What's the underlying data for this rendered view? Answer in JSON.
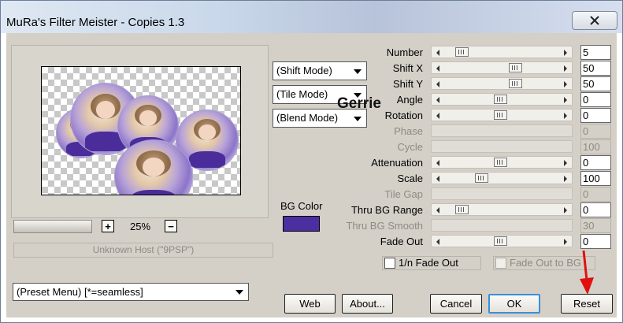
{
  "window": {
    "title": "MuRa's Filter Meister - Copies 1.3"
  },
  "preview": {
    "zoom": "25%",
    "host": "Unknown Host (\"9PSP\")"
  },
  "modes": {
    "shift": "(Shift Mode)",
    "tile": "(Tile Mode)",
    "blend": "(Blend Mode)"
  },
  "overlay_name": "Gerrie",
  "bg_color": {
    "label": "BG Color",
    "value": "#4b2fa0"
  },
  "params": [
    {
      "label": "Number",
      "value": "5",
      "fraction": 0.12,
      "disabled": false
    },
    {
      "label": "Shift X",
      "value": "50",
      "fraction": 0.62,
      "disabled": false
    },
    {
      "label": "Shift Y",
      "value": "50",
      "fraction": 0.62,
      "disabled": false
    },
    {
      "label": "Angle",
      "value": "0",
      "fraction": 0.48,
      "disabled": false
    },
    {
      "label": "Rotation",
      "value": "0",
      "fraction": 0.48,
      "disabled": false
    },
    {
      "label": "Phase",
      "value": "0",
      "fraction": null,
      "disabled": true
    },
    {
      "label": "Cycle",
      "value": "100",
      "fraction": null,
      "disabled": true
    },
    {
      "label": "Attenuation",
      "value": "0",
      "fraction": 0.48,
      "disabled": false
    },
    {
      "label": "Scale",
      "value": "100",
      "fraction": 0.3,
      "disabled": false
    },
    {
      "label": "Tile Gap",
      "value": "0",
      "fraction": null,
      "disabled": true
    },
    {
      "label": "Thru BG Range",
      "value": "0",
      "fraction": 0.12,
      "disabled": false
    },
    {
      "label": "Thru BG Smooth",
      "value": "30",
      "fraction": null,
      "disabled": true
    },
    {
      "label": "Fade Out",
      "value": "0",
      "fraction": 0.48,
      "disabled": false
    }
  ],
  "checkboxes": {
    "one_n_fade_out": "1/n Fade Out",
    "fade_out_to_bg": "Fade Out to BG"
  },
  "preset": {
    "value": "(Preset Menu)  [*=seamless]"
  },
  "buttons": {
    "web": "Web",
    "about": "About...",
    "cancel": "Cancel",
    "ok": "OK",
    "reset": "Reset"
  },
  "icons": {
    "close": "close-icon",
    "zoom_in": "plus-icon",
    "zoom_out": "minus-icon",
    "arrow": "red-arrow-icon"
  },
  "colors": {
    "dialog": "#d4d0c8",
    "annotation_arrow": "#e01010",
    "ok_focus": "#3c8fd6"
  }
}
